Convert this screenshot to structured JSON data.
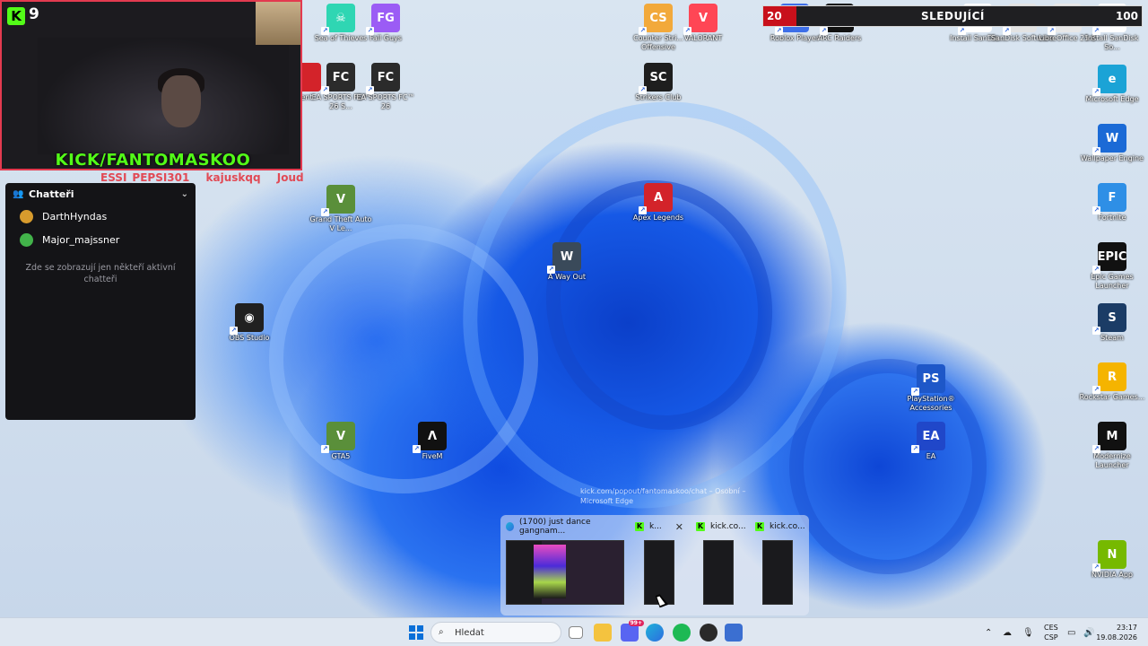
{
  "webcam": {
    "kick_badge": "K",
    "viewer_count": "9",
    "handle": "KICK/FANTOMASKOO"
  },
  "chat_overlay_names": [
    "ESSI_PEPSI301",
    "kajuskqq",
    "Joud"
  ],
  "chatters_panel": {
    "title": "Chatteři",
    "users": [
      {
        "name": "DarthHyndas",
        "avatar_color": "#d79b2d"
      },
      {
        "name": "Major_majssner",
        "avatar_color": "#42b34a"
      }
    ],
    "note": "Zde se zobrazují jen někteří aktivní chatteři"
  },
  "follow_goal": {
    "current": "20",
    "label": "SLEDUJÍCÍ",
    "goal": "100",
    "progress": 0.2,
    "partial_icon_text": "C\naders"
  },
  "desktop_icons": [
    {
      "id": "sea-of-thieves",
      "label": "Sea of Thieves",
      "color": "#2fd6b3",
      "glyph": "☠"
    },
    {
      "id": "fall-guys",
      "label": "Fall Guys",
      "color": "#9b5cf5",
      "glyph": "FG"
    },
    {
      "id": "ea-fc26-a",
      "label": "EA SPORTS FC™ 26 S...",
      "color": "#2b2b2b",
      "glyph": "FC"
    },
    {
      "id": "ea-fc26-b",
      "label": "EA SPORTS FC™ 26",
      "color": "#2b2b2b",
      "glyph": "FC"
    },
    {
      "id": "counter-strike",
      "label": "Counter Stri... Offensive",
      "color": "#f2a93b",
      "glyph": "CS"
    },
    {
      "id": "valorant",
      "label": "VALORANT",
      "color": "#ff4655",
      "glyph": "V"
    },
    {
      "id": "roblox",
      "label": "Roblox Player",
      "color": "#3d6ee8",
      "glyph": "R"
    },
    {
      "id": "arc-raiders",
      "label": "ARC Raiders",
      "color": "#111111",
      "glyph": "A"
    },
    {
      "id": "install-sandisk",
      "label": "Install SanDis...",
      "color": "#ffffff",
      "glyph": "⚙"
    },
    {
      "id": "sandisk-software",
      "label": "SanDisk Software",
      "color": "#e3e3e3",
      "glyph": "PDF"
    },
    {
      "id": "libreoffice",
      "label": "LibreOffice 25.8",
      "color": "#e8e8e8",
      "glyph": "L"
    },
    {
      "id": "install-sandisk-2",
      "label": "Install SanDisk So...",
      "color": "#ffffff",
      "glyph": "⚙"
    },
    {
      "id": "strikers-club",
      "label": "Strikers Club",
      "color": "#1e1e1e",
      "glyph": "SC"
    },
    {
      "id": "grand-theft-auto",
      "label": "Grand Theft Auto V Le...",
      "color": "#5a8f3a",
      "glyph": "V"
    },
    {
      "id": "apex-legends",
      "label": "Apex Legends",
      "color": "#d3232a",
      "glyph": "A"
    },
    {
      "id": "a-way-out",
      "label": "A Way Out",
      "color": "#3a4a5a",
      "glyph": "W"
    },
    {
      "id": "obs-studio",
      "label": "OBS Studio",
      "color": "#202020",
      "glyph": "◉"
    },
    {
      "id": "gta5",
      "label": "GTA5",
      "color": "#5a8f3a",
      "glyph": "V"
    },
    {
      "id": "fivem",
      "label": "FiveM",
      "color": "#111111",
      "glyph": "Λ"
    },
    {
      "id": "playstation-accessories",
      "label": "PlayStation® Accessories",
      "color": "#1e57c8",
      "glyph": "PS"
    },
    {
      "id": "ea",
      "label": "EA",
      "color": "#2047c9",
      "glyph": "EA"
    },
    {
      "id": "microsoft-edge",
      "label": "Microsoft Edge",
      "color": "#1ba3d6",
      "glyph": "e"
    },
    {
      "id": "wallpaper-engine",
      "label": "Wallpaper Engine",
      "color": "#1b6ad6",
      "glyph": "W"
    },
    {
      "id": "fortnite",
      "label": "Fortnite",
      "color": "#2e8fe6",
      "glyph": "F"
    },
    {
      "id": "epic-games",
      "label": "Epic Games Launcher",
      "color": "#111111",
      "glyph": "EPIC"
    },
    {
      "id": "steam",
      "label": "Steam",
      "color": "#1b3c66",
      "glyph": "S"
    },
    {
      "id": "rockstar",
      "label": "Rockstar Games...",
      "color": "#f5b400",
      "glyph": "R"
    },
    {
      "id": "modernize",
      "label": "Modernize Launcher",
      "color": "#111111",
      "glyph": "M"
    },
    {
      "id": "nvidia-app",
      "label": "NVIDIA App",
      "color": "#76b900",
      "glyph": "N"
    },
    {
      "id": "partial-left",
      "label": "ent",
      "color": "#d3232a",
      "glyph": ""
    }
  ],
  "tooltip": "kick.com/popout/fantomaskoo/chat – Osobní – Microsoft Edge",
  "thumbnails": [
    {
      "title": "(1700) just dance gangnam...",
      "type": "edge"
    },
    {
      "title": "k...",
      "type": "kick",
      "close": "✕"
    },
    {
      "title": "kick.co...",
      "type": "kick"
    },
    {
      "title": "kick.co...",
      "type": "kick"
    }
  ],
  "taskbar": {
    "search_placeholder": "Hledat",
    "discord_badge": "99+",
    "lang_top": "CES",
    "lang_bottom": "CSP",
    "time": "23:17",
    "date": "19.08.2026"
  }
}
